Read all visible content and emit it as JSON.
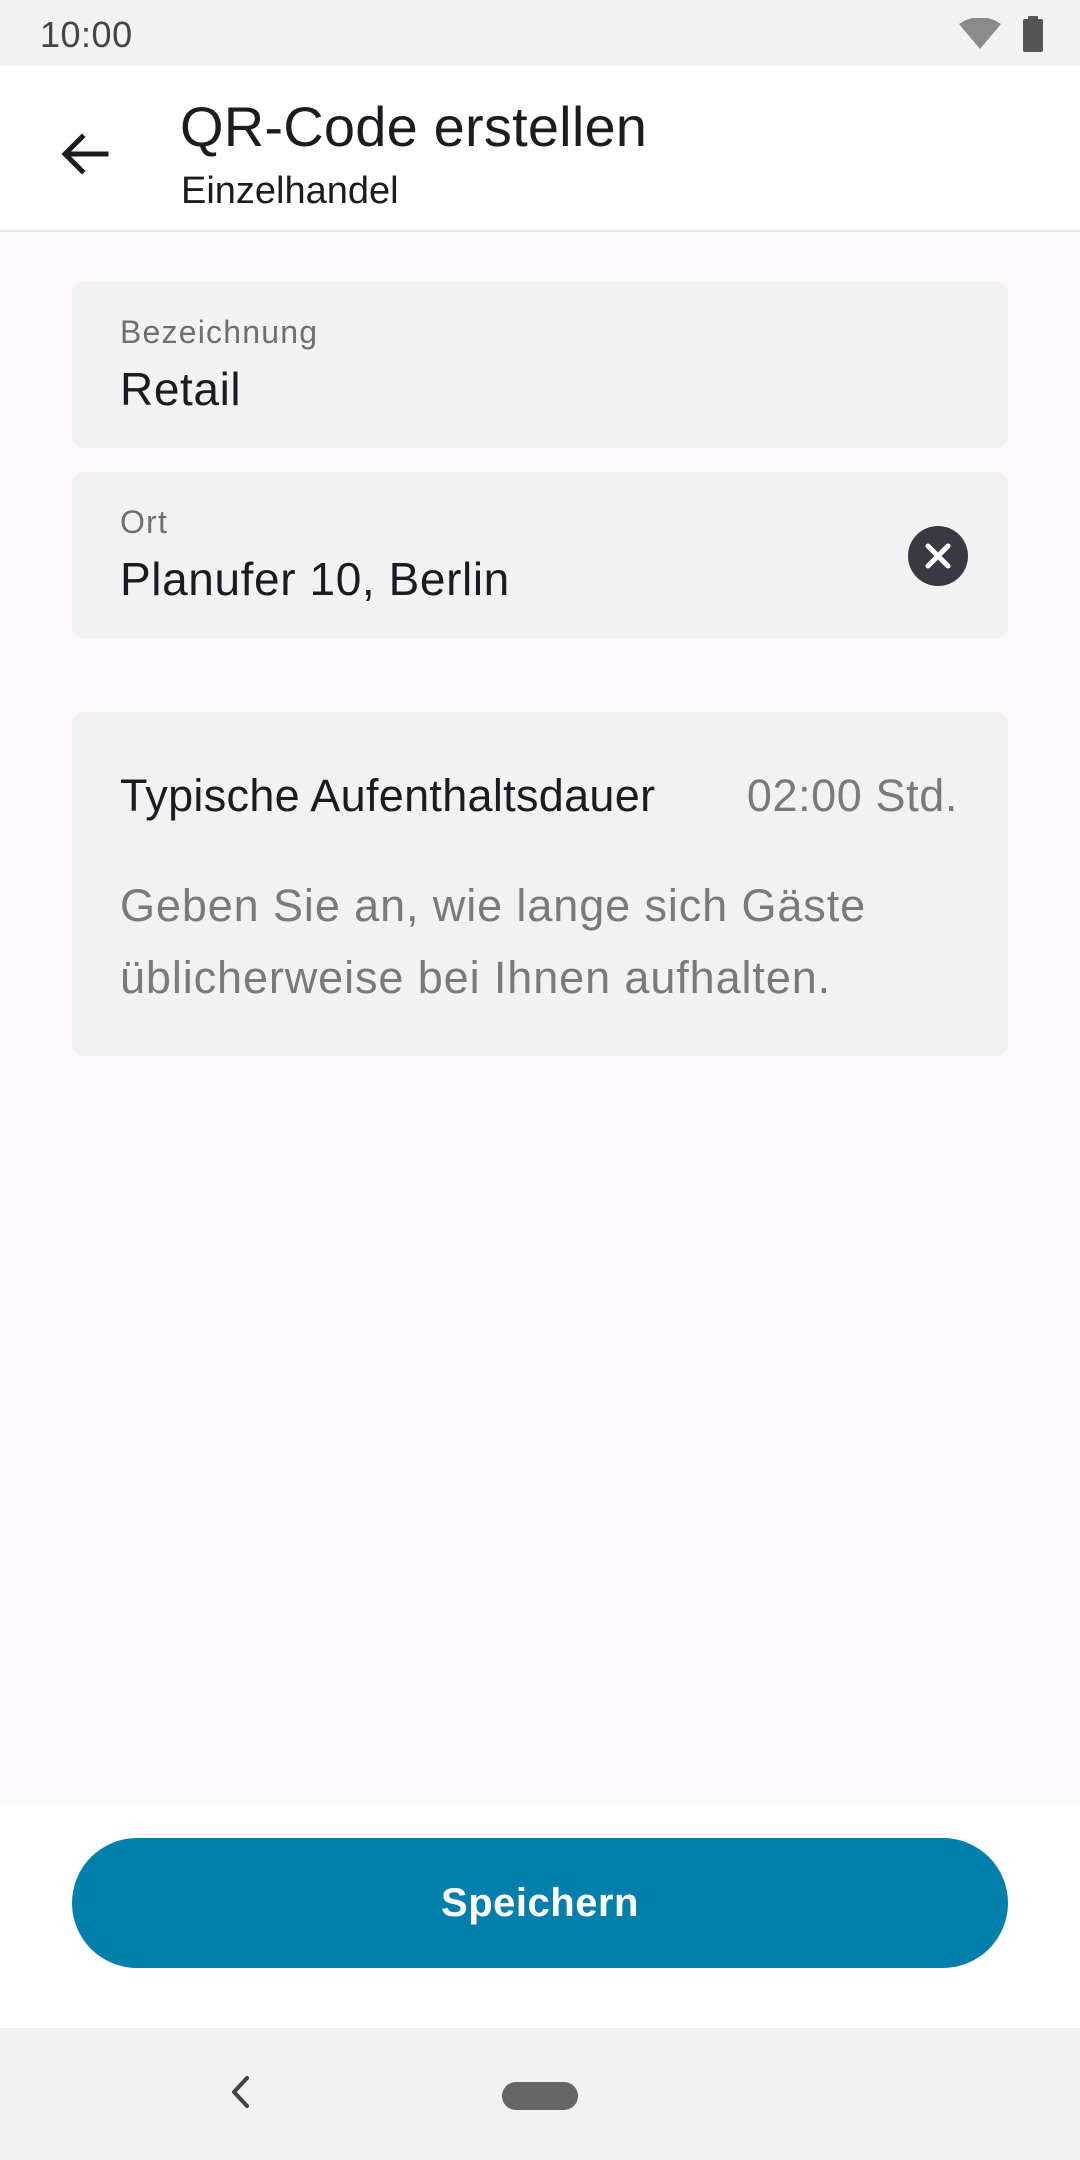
{
  "status_bar": {
    "time": "10:00",
    "icons": [
      "wifi-icon",
      "battery-icon"
    ]
  },
  "app_bar": {
    "back_icon": "arrow-left-icon",
    "title": "QR-Code erstellen",
    "subtitle": "Einzelhandel"
  },
  "form": {
    "name_field": {
      "label": "Bezeichnung",
      "value": "Retail"
    },
    "location_field": {
      "label": "Ort",
      "value": "Planufer 10, Berlin",
      "clear_icon": "clear-circle-icon"
    },
    "duration": {
      "label": "Typische Aufenthaltsdauer",
      "value": "02:00 Std.",
      "hint": "Geben Sie an, wie lange sich Gäste üblicherweise bei Ihnen aufhalten."
    }
  },
  "actions": {
    "save_label": "Speichern"
  },
  "nav_bar": {
    "icons": [
      "nav-back-icon",
      "nav-home-pill"
    ]
  },
  "colors": {
    "primary": "#007fad",
    "surface": "#fdf8fc",
    "field_background": "#f2f2f2",
    "secondary_text": "#7a7a7a"
  }
}
